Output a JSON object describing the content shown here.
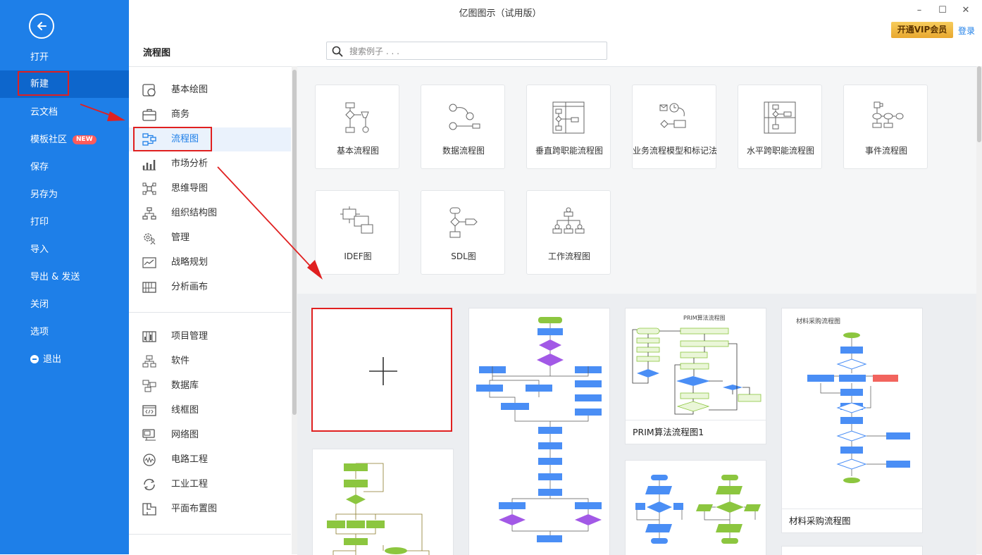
{
  "app": {
    "title": "亿图图示（试用版）",
    "vip_label": "开通VIP会员",
    "login_label": "登录"
  },
  "window_controls": {
    "minimize": "–",
    "maximize": "☐",
    "close": "✕"
  },
  "sidebar": {
    "back_icon": "back-arrow-icon",
    "items": [
      {
        "label": "打开"
      },
      {
        "label": "新建",
        "active": true
      },
      {
        "label": "云文档"
      },
      {
        "label": "模板社区",
        "badge": "NEW"
      },
      {
        "label": "保存"
      },
      {
        "label": "另存为"
      },
      {
        "label": "打印"
      },
      {
        "label": "导入"
      },
      {
        "label": "导出 & 发送"
      },
      {
        "label": "关闭"
      },
      {
        "label": "选项"
      },
      {
        "label": "退出",
        "icon": "minus-circle-icon"
      }
    ]
  },
  "section_title": "流程图",
  "search": {
    "placeholder": "搜索例子 . . ."
  },
  "categories": {
    "group1": [
      {
        "label": "基本绘图",
        "icon": "basic-shapes-icon"
      },
      {
        "label": "商务",
        "icon": "briefcase-icon"
      },
      {
        "label": "流程图",
        "icon": "flowchart-icon",
        "active": true
      },
      {
        "label": "市场分析",
        "icon": "bar-chart-icon"
      },
      {
        "label": "思维导图",
        "icon": "mindmap-icon"
      },
      {
        "label": "组织结构图",
        "icon": "org-chart-icon"
      },
      {
        "label": "管理",
        "icon": "gear-people-icon"
      },
      {
        "label": "战略规划",
        "icon": "strategy-icon"
      },
      {
        "label": "分析画布",
        "icon": "canvas-grid-icon"
      }
    ],
    "group2": [
      {
        "label": "项目管理",
        "icon": "project-icon"
      },
      {
        "label": "软件",
        "icon": "software-icon"
      },
      {
        "label": "数据库",
        "icon": "database-icon"
      },
      {
        "label": "线框图",
        "icon": "wireframe-icon"
      },
      {
        "label": "网络图",
        "icon": "network-icon"
      },
      {
        "label": "电路工程",
        "icon": "circuit-icon"
      },
      {
        "label": "工业工程",
        "icon": "industrial-icon"
      },
      {
        "label": "平面布置图",
        "icon": "floorplan-icon"
      }
    ]
  },
  "diagram_types": [
    {
      "label": "基本流程图"
    },
    {
      "label": "数据流程图"
    },
    {
      "label": "垂直跨职能流程图"
    },
    {
      "label": "业务流程模型和标记法"
    },
    {
      "label": "水平跨职能流程图"
    },
    {
      "label": "事件流程图"
    },
    {
      "label": "IDEF图"
    },
    {
      "label": "SDL图"
    },
    {
      "label": "工作流程图"
    }
  ],
  "templates": {
    "blank_icon": "plus-icon",
    "items": [
      {
        "caption": "PRIM算法流程图1",
        "heading": "PRIM算法流程图"
      },
      {
        "caption": "材料采购流程图",
        "heading": "材料采购流程图"
      }
    ]
  },
  "colors": {
    "sidebar_blue": "#1e7fe8",
    "highlight_red": "#e02020",
    "flow_blue": "#4a8ef5",
    "flow_green": "#8cc63f",
    "flow_purple": "#a259e6"
  }
}
